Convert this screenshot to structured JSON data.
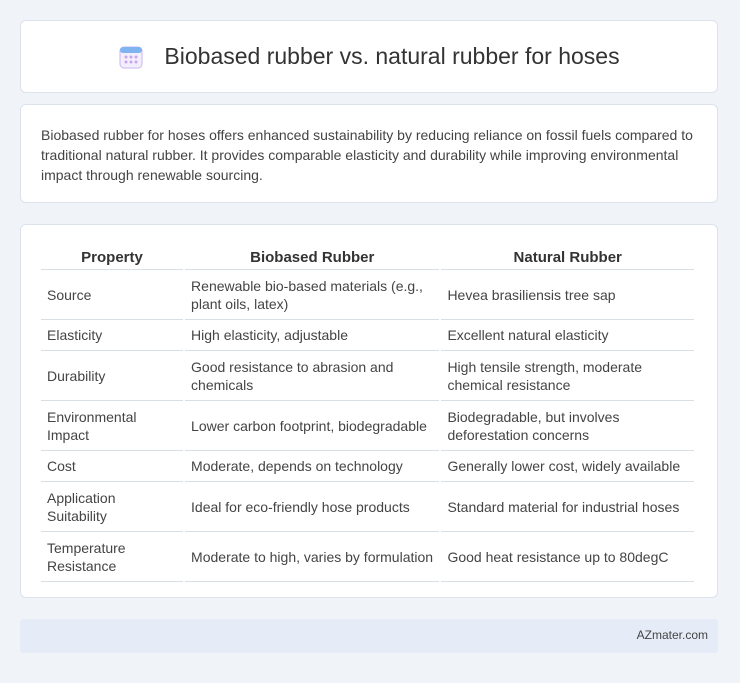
{
  "header": {
    "title": "Biobased rubber vs. natural rubber for hoses",
    "icon": "calendar-icon"
  },
  "summary": {
    "text": "Biobased rubber for hoses offers enhanced sustainability by reducing reliance on fossil fuels compared to traditional natural rubber. It provides comparable elasticity and durability while improving environmental impact through renewable sourcing."
  },
  "table": {
    "headers": [
      "Property",
      "Biobased Rubber",
      "Natural Rubber"
    ],
    "rows": [
      [
        "Source",
        "Renewable bio-based materials (e.g., plant oils, latex)",
        "Hevea brasiliensis tree sap"
      ],
      [
        "Elasticity",
        "High elasticity, adjustable",
        "Excellent natural elasticity"
      ],
      [
        "Durability",
        "Good resistance to abrasion and chemicals",
        "High tensile strength, moderate chemical resistance"
      ],
      [
        "Environmental Impact",
        "Lower carbon footprint, biodegradable",
        "Biodegradable, but involves deforestation concerns"
      ],
      [
        "Cost",
        "Moderate, depends on technology",
        "Generally lower cost, widely available"
      ],
      [
        "Application Suitability",
        "Ideal for eco-friendly hose products",
        "Standard material for industrial hoses"
      ],
      [
        "Temperature Resistance",
        "Moderate to high, varies by formulation",
        "Good heat resistance up to 80degC"
      ]
    ]
  },
  "footer": {
    "brand": "AZmater.com"
  },
  "colors": {
    "background": "#f0f3f8",
    "card": "#ffffff",
    "footer": "#e6ecf7"
  }
}
